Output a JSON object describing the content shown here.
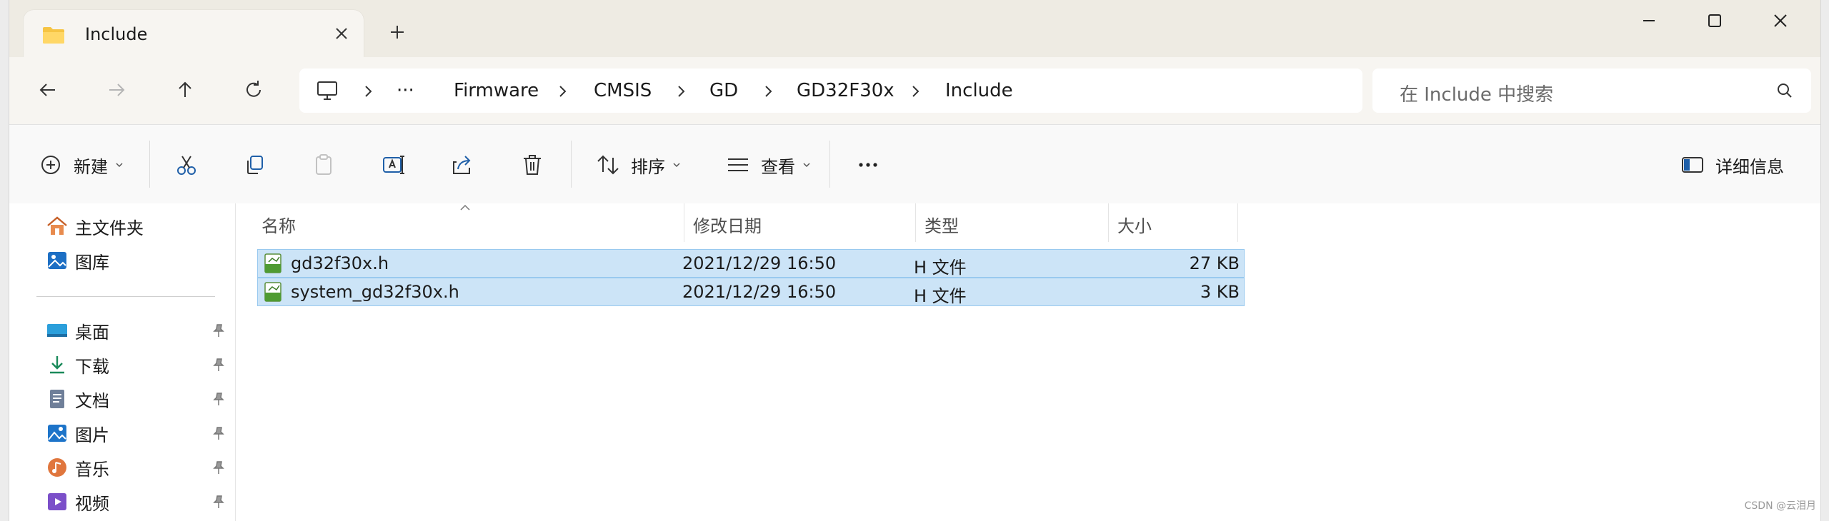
{
  "tab": {
    "title": "Include",
    "close_icon": "close-icon",
    "new_tab_icon": "plus-icon"
  },
  "window_controls": {
    "minimize": "minimize-icon",
    "maximize": "maximize-icon",
    "close": "close-icon"
  },
  "nav": {
    "back": "arrow-left-icon",
    "forward": "arrow-right-icon",
    "up": "arrow-up-icon",
    "refresh": "refresh-icon"
  },
  "breadcrumb": {
    "root_icon": "this-pc-icon",
    "overflow": "···",
    "items": [
      "Firmware",
      "CMSIS",
      "GD",
      "GD32F30x",
      "Include"
    ]
  },
  "search": {
    "placeholder": "在 Include 中搜索"
  },
  "commands": {
    "new_label": "新建",
    "sort_label": "排序",
    "view_label": "查看",
    "details_label": "详细信息",
    "more": "more-icon"
  },
  "sidebar": {
    "top": [
      {
        "label": "主文件夹",
        "icon": "home-icon"
      },
      {
        "label": "图库",
        "icon": "gallery-icon"
      }
    ],
    "pinned": [
      {
        "label": "桌面",
        "icon": "desktop-icon"
      },
      {
        "label": "下载",
        "icon": "download-icon"
      },
      {
        "label": "文档",
        "icon": "documents-icon"
      },
      {
        "label": "图片",
        "icon": "pictures-icon"
      },
      {
        "label": "音乐",
        "icon": "music-icon"
      },
      {
        "label": "视频",
        "icon": "videos-icon"
      }
    ]
  },
  "columns": {
    "name": "名称",
    "modified": "修改日期",
    "type": "类型",
    "size": "大小"
  },
  "files": [
    {
      "name": "gd32f30x.h",
      "modified": "2021/12/29 16:50",
      "type": "H 文件",
      "size": "27 KB",
      "selected": true
    },
    {
      "name": "system_gd32f30x.h",
      "modified": "2021/12/29 16:50",
      "type": "H 文件",
      "size": "3 KB",
      "selected": true
    }
  ],
  "watermark": "CSDN @云泪月",
  "colors": {
    "selection": "#cce4f7",
    "selection_border": "#99c9ef",
    "titlebar": "#eeebe3",
    "accent": "#0067c0"
  }
}
